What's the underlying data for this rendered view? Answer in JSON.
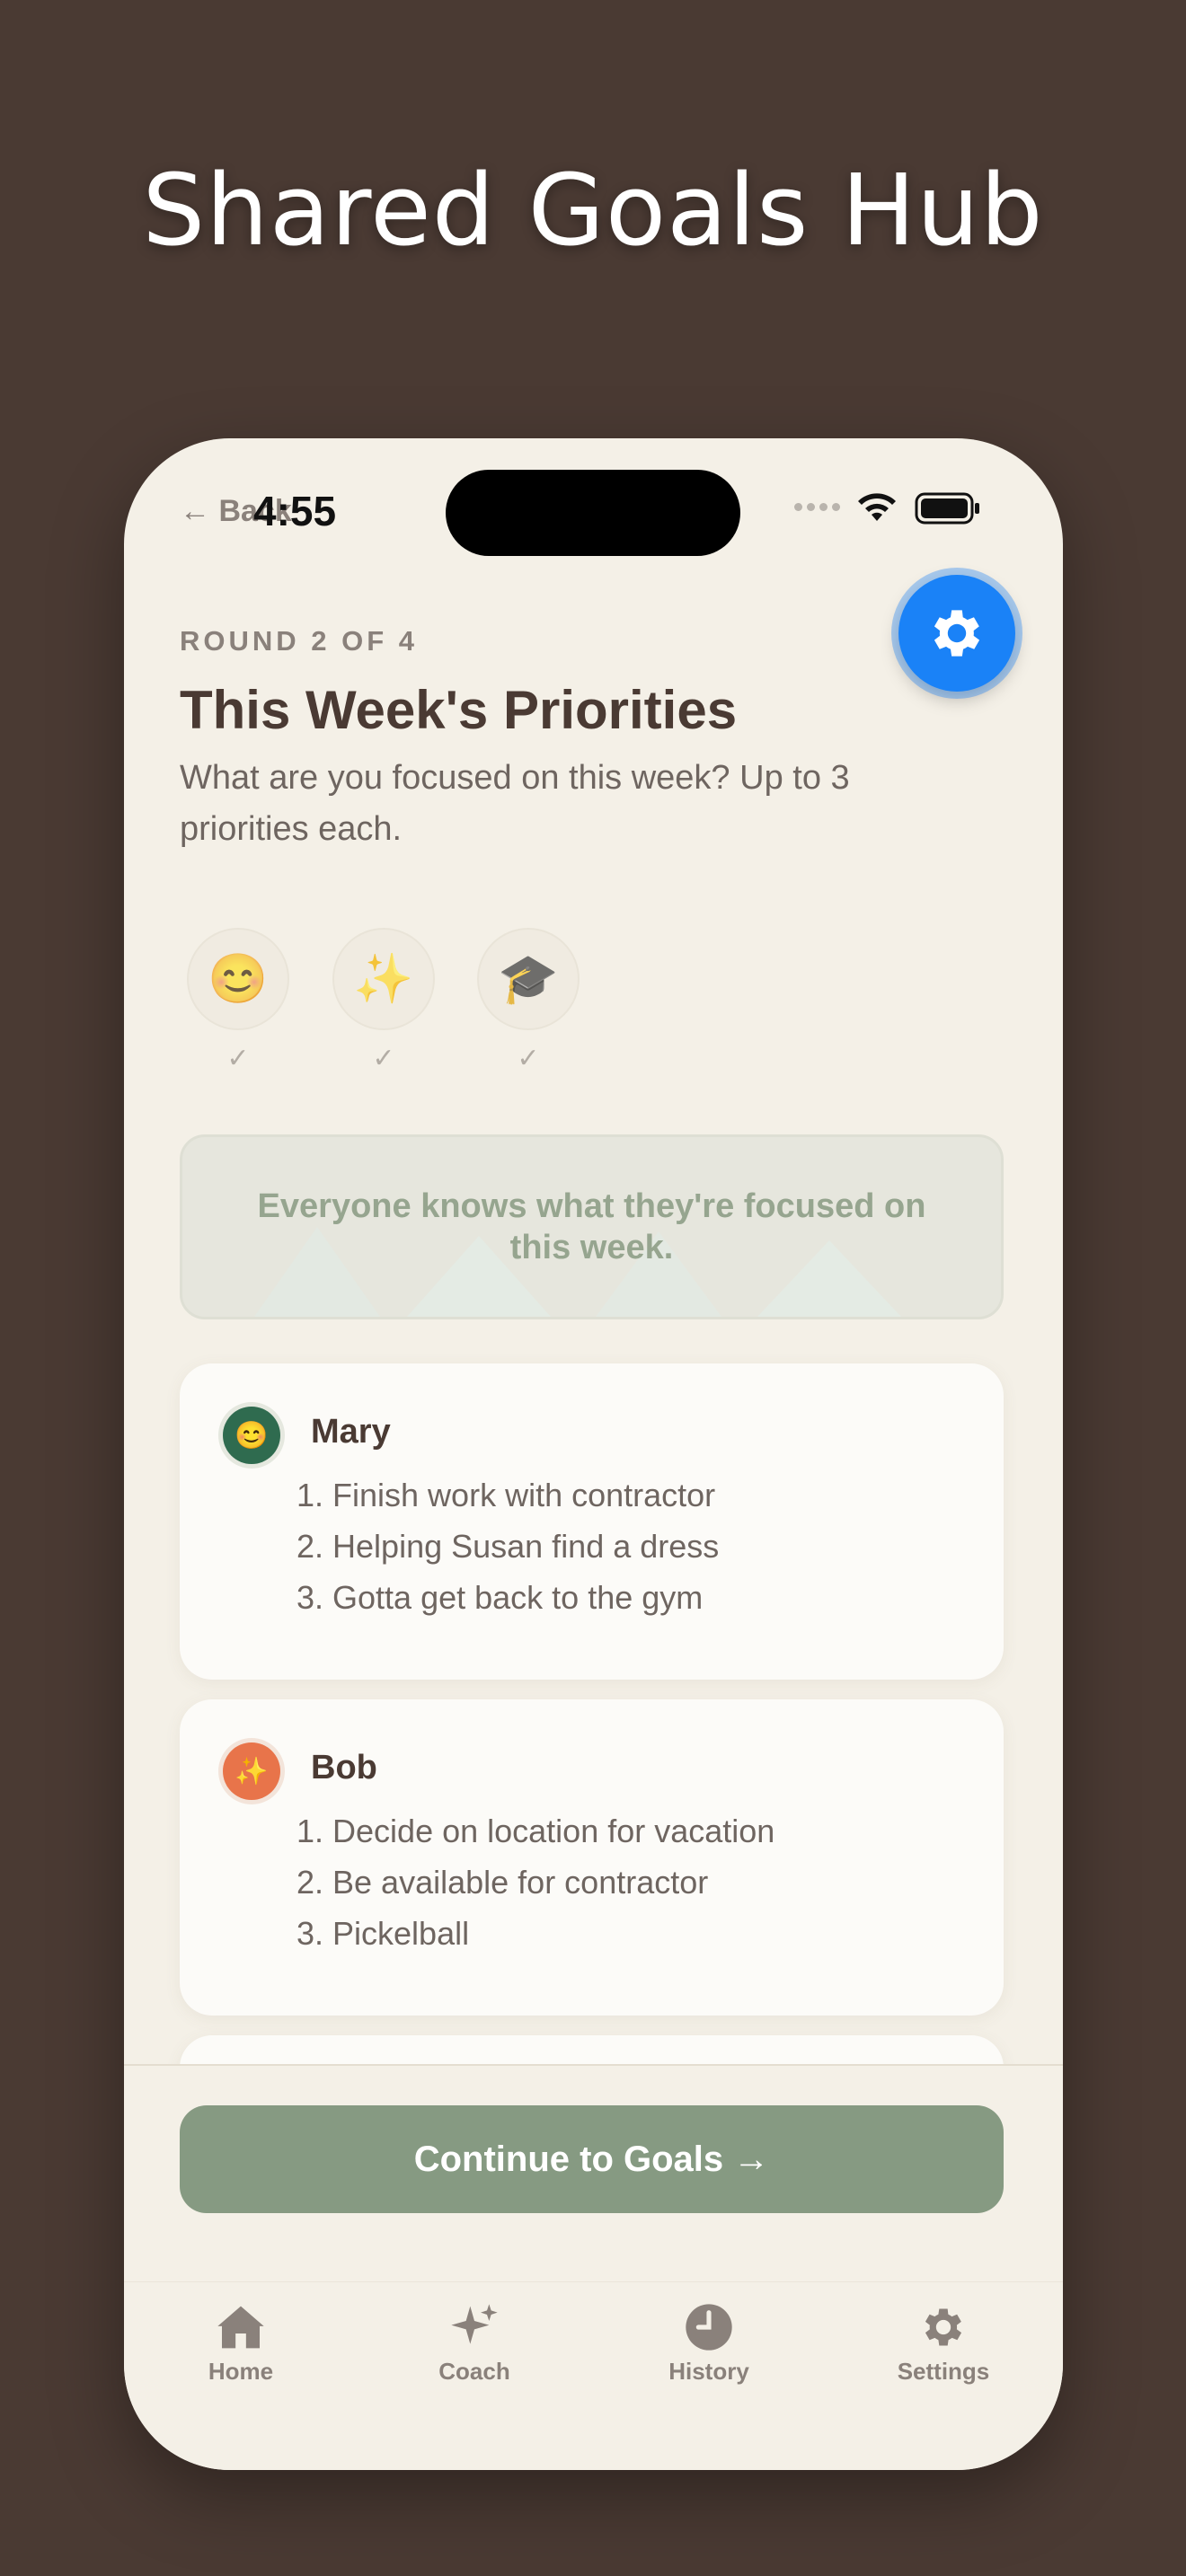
{
  "hero": {
    "title": "Shared Goals Hub"
  },
  "status_bar": {
    "back_label": "← Back",
    "time": "4:55"
  },
  "header": {
    "round_label": "ROUND 2 OF 4",
    "title": "This Week's Priorities",
    "subtitle": "What are you focused on this week? Up to 3 priorities each."
  },
  "participants": [
    {
      "emoji": "😊",
      "check": "✓"
    },
    {
      "emoji": "✨",
      "check": "✓"
    },
    {
      "emoji": "🎓",
      "check": "✓"
    }
  ],
  "banner": {
    "text": "Everyone knows what they're focused on this week."
  },
  "cards": [
    {
      "name": "Mary",
      "avatar_emoji": "😊",
      "avatar_color": "#2f6b4f",
      "priorities": [
        "1. Finish work with contractor",
        "2. Helping Susan find a dress",
        "3. Gotta get back to the gym"
      ]
    },
    {
      "name": "Bob",
      "avatar_emoji": "✨",
      "avatar_color": "#e8744a",
      "priorities": [
        "1. Decide on location for vacation",
        "2. Be available for contractor",
        "3. Pickelball"
      ]
    }
  ],
  "continue_button": {
    "label": "Continue to Goals →"
  },
  "tabs": [
    {
      "label": "Home",
      "icon": "home-icon"
    },
    {
      "label": "Coach",
      "icon": "sparkle-icon"
    },
    {
      "label": "History",
      "icon": "clock-icon"
    },
    {
      "label": "Settings",
      "icon": "gear-icon"
    }
  ],
  "colors": {
    "background": "#4a3a33",
    "surface": "#f4f0e7",
    "accent_blue": "#1a82f7",
    "button_green": "#869a82"
  }
}
